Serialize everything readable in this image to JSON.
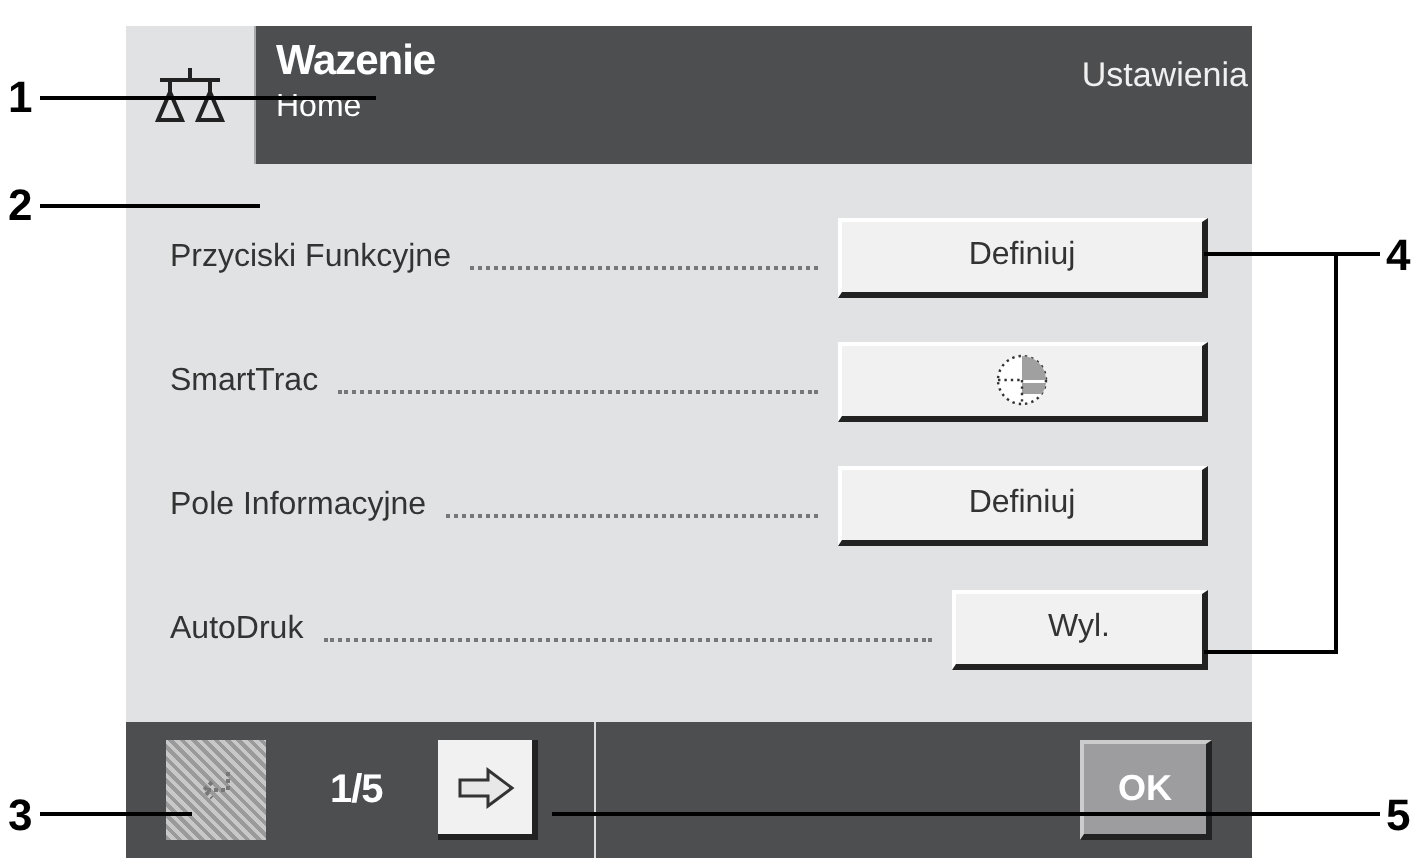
{
  "header": {
    "title": "Wazenie",
    "subtitle": "Home",
    "menu": "Ustawienia"
  },
  "rows": [
    {
      "label": "Przyciski Funkcyjne",
      "kind": "text",
      "compact": false,
      "value": "Definiuj"
    },
    {
      "label": "SmartTrac",
      "kind": "icon",
      "compact": false
    },
    {
      "label": "Pole Informacyjne",
      "kind": "text",
      "compact": false,
      "value": "Definiuj"
    },
    {
      "label": "AutoDruk",
      "kind": "text",
      "compact": true,
      "value": "Wyl."
    }
  ],
  "footer": {
    "back_disabled": true,
    "page": "1/5",
    "ok": "OK"
  },
  "callouts": [
    "1",
    "2",
    "3",
    "4",
    "5"
  ]
}
